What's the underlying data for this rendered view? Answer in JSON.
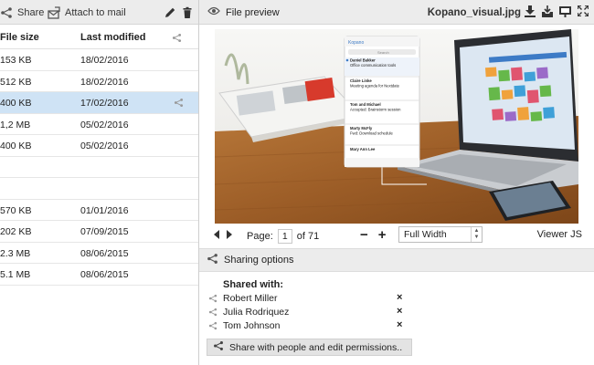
{
  "left_toolbar": {
    "share_label": "Share",
    "attach_label": "Attach to mail",
    "share_icon": "share-icon",
    "attach_icon": "attach-mail-icon",
    "edit_icon": "pencil-icon",
    "delete_icon": "trash-icon"
  },
  "file_list": {
    "columns": [
      "File size",
      "Last modified"
    ],
    "share_icon": "share-icon",
    "rows": [
      {
        "size": "153 KB",
        "modified": "18/02/2016"
      },
      {
        "size": "512 KB",
        "modified": "18/02/2016"
      },
      {
        "size": "400 KB",
        "modified": "17/02/2016",
        "selected": true
      },
      {
        "size": "1,2 MB",
        "modified": "05/02/2016"
      },
      {
        "size": "400 KB",
        "modified": "05/02/2016"
      },
      {
        "size": "",
        "modified": ""
      },
      {
        "size": "",
        "modified": ""
      },
      {
        "size": "570 KB",
        "modified": "01/01/2016"
      },
      {
        "size": "202 KB",
        "modified": "07/09/2015"
      },
      {
        "size": "2.3 MB",
        "modified": "08/06/2015"
      },
      {
        "size": "5.1 MB",
        "modified": "08/06/2015"
      }
    ]
  },
  "right_toolbar": {
    "title": "File preview",
    "filename": "Kopano_visual.jpg",
    "eye_icon": "eye-icon",
    "actions": [
      "download-icon",
      "save-icon",
      "present-icon",
      "fullscreen-icon"
    ]
  },
  "preview_image": {
    "description_icon": "laptop-photo",
    "app_name": "Kopano",
    "search_label": "Search",
    "mail_items": [
      {
        "from": "Daniel Bakker",
        "subject": "Office communication tools"
      },
      {
        "from": "Claire Linke",
        "subject": "Meeting agenda for Nextdate"
      },
      {
        "from": "Tom and Michael",
        "subject": "Accepted: Brainstorm session"
      },
      {
        "from": "Marty McFly",
        "subject": "Fwd: Download schedule"
      },
      {
        "from": "Mary Ann Lee",
        "subject": ""
      }
    ]
  },
  "viewer": {
    "page_label": "Page:",
    "page_value": "1",
    "page_total": "of 71",
    "zoom_minus": "−",
    "zoom_plus": "+",
    "zoom_select": "Full Width",
    "viewer_label": "Viewer JS"
  },
  "sharing": {
    "header": "Sharing options",
    "shared_with": "Shared with:",
    "people": [
      {
        "name": "Robert Miller"
      },
      {
        "name": "Julia Rodriquez"
      },
      {
        "name": "Tom Johnson"
      }
    ],
    "remove_glyph": "×",
    "button_label": "Share with people and edit permissions.."
  },
  "colors": {
    "toolbar_bg": "#ececec",
    "selected_row": "#cfe3f5",
    "wood": "#a3652d"
  }
}
